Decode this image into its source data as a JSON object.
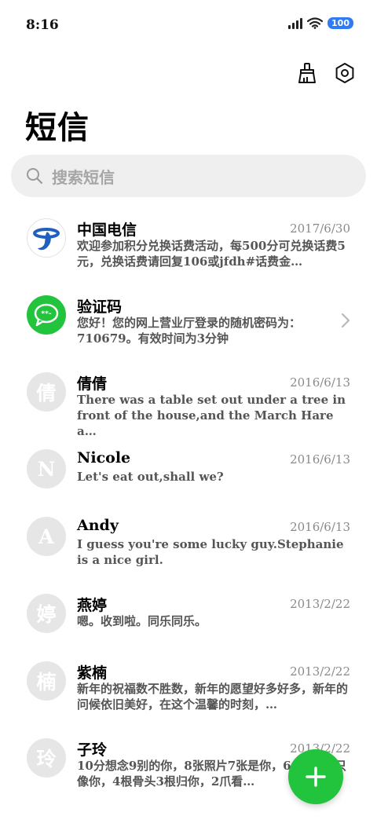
{
  "status_bar": {
    "time": "8:16",
    "battery": "100"
  },
  "header": {
    "title": "短信"
  },
  "search": {
    "placeholder": "搜索短信"
  },
  "messages": [
    {
      "name": "中国电信",
      "date": "2017/6/30",
      "preview": "欢迎参加积分兑换话费活动，每500分可兑换话费5元，兑换话费请回复106或jfdh#话费金…",
      "avatar": "telecom-logo"
    },
    {
      "name": "验证码",
      "date": "",
      "preview": "您好！您的网上营业厅登录的随机密码为：710679。有效时间为3分钟",
      "avatar": "chat-bubble"
    },
    {
      "name": "倩倩",
      "date": "2016/6/13",
      "preview": "There was a table set out under a tree in front of the house,and the March Hare a…",
      "avatar_text": "倩"
    },
    {
      "name": "Nicole",
      "date": "2016/6/13",
      "preview": "Let's eat out,shall we?",
      "avatar_text": "N"
    },
    {
      "name": "Andy",
      "date": "2016/6/13",
      "preview": "I guess you're some lucky guy.Stephanie is a nice girl.",
      "avatar_text": "A"
    },
    {
      "name": "燕婷",
      "date": "2013/2/22",
      "preview": "嗯。收到啦。同乐同乐。",
      "avatar_text": "婷"
    },
    {
      "name": "紫楠",
      "date": "2013/2/22",
      "preview": "新年的祝福数不胜数，新年的愿望好多好多，新年的问候依旧美好，在这个温馨的时刻，…",
      "avatar_text": "楠"
    },
    {
      "name": "子玲",
      "date": "2013/2/22",
      "preview": "10分想念9别的你，8张照片7张是你，6条小狗5只像你，4根骨头3根归你，2爪看…",
      "avatar_text": "玲"
    }
  ],
  "colors": {
    "accent_green": "#22c33d",
    "battery_blue": "#2f7bf5",
    "search_bg": "#efefef"
  },
  "icons": {
    "toolbar": [
      "broom-icon",
      "settings-icon"
    ],
    "fab": "plus-icon"
  }
}
